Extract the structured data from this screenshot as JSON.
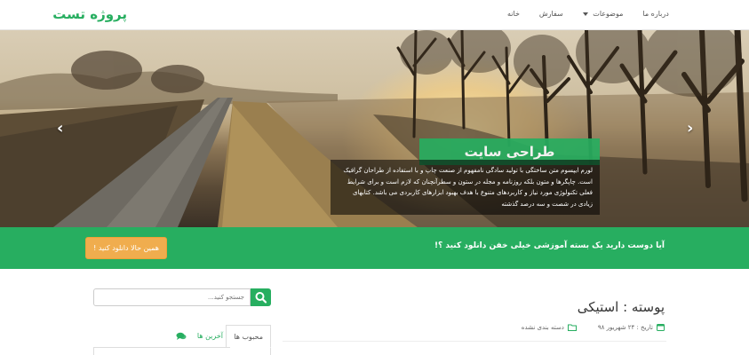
{
  "navbar": {
    "brand": "پروژه تست",
    "links": {
      "home": "خانه",
      "order": "سفارش",
      "topics": "موضوعات",
      "about": "درباره ما"
    }
  },
  "hero": {
    "title": "طراحی سایت",
    "text": "لورم ایپسوم متن ساختگی با تولید سادگی نامفهوم از صنعت چاپ و با استفاده از طراحان گرافیک است. چاپگرها و متون بلکه روزنامه و مجله در ستون و سطرآنچنان که لازم است و برای شرایط فعلی تکنولوژی مورد نیاز و کاربردهای متنوع با هدف بهبود ابزارهای کاربردی می باشد. کتابهای زیادی در شصت و سه درصد گذشته",
    "prev_arrow": "‹",
    "next_arrow": "›",
    "slide_count": 4,
    "active_slide": 4
  },
  "cta": {
    "text": "آیا دوست دارید یک بسته آموزشی خیلی خفن دانلود کنید ؟!",
    "button": "همین حالا دانلود کنید !"
  },
  "sidebar": {
    "search_placeholder": "جستجو کنید...",
    "tab_popular": "محبوب ها",
    "tab_latest": "آخرین ها"
  },
  "post": {
    "title": "پوسته : استیکی",
    "date": "تاریخ : ۲۴ شهریور ۹۸",
    "category": "دسته بندی نشده"
  },
  "colors": {
    "accent": "#27ae60",
    "button": "#f0ad4e"
  }
}
